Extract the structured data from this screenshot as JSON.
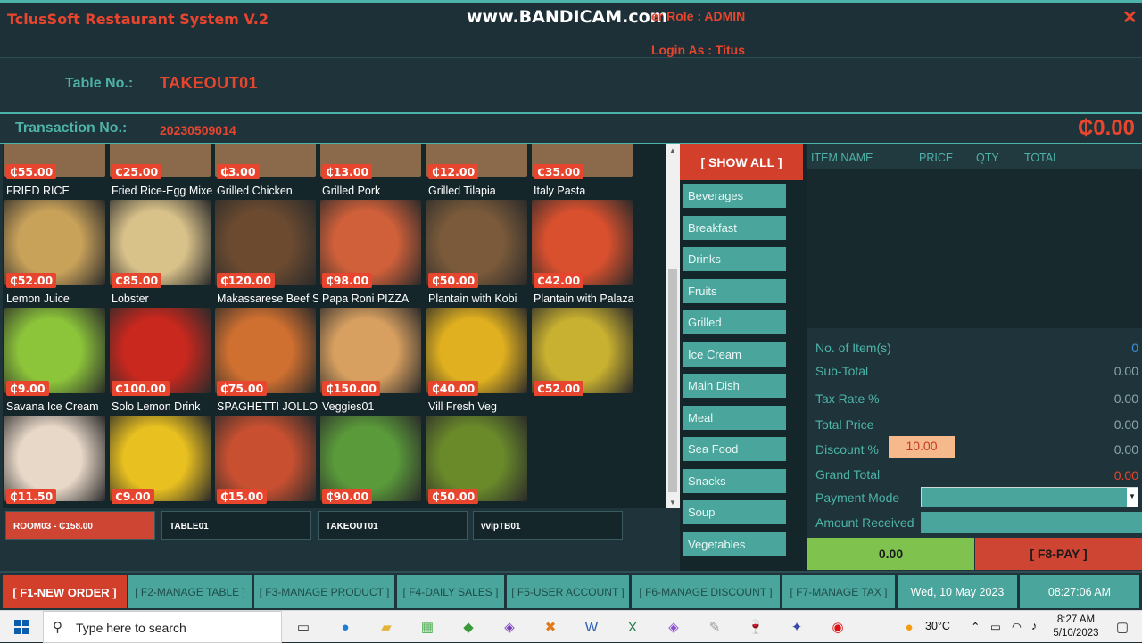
{
  "header": {
    "app_title": "TclusSoft Restaurant System V.2",
    "watermark": "www.BANDICAM.com",
    "user_role": "er Role : ADMIN",
    "login_as": "Login As : Titus",
    "table_label": "Table No.:",
    "table_value": "TAKEOUT01",
    "transaction_label": "Transaction No.:",
    "transaction_value": "20230509014",
    "grand_total_display": "₵0.00"
  },
  "products_top_row_prices": [
    "₵55.00",
    "₵25.00",
    "₵3.00",
    "₵13.00",
    "₵12.00",
    "₵35.00"
  ],
  "products": [
    {
      "name": "FRIED RICE",
      "price": "₵52.00",
      "color": "#c9a25a"
    },
    {
      "name": "Fried Rice-Egg Mixe",
      "price": "₵85.00",
      "color": "#d9c28a"
    },
    {
      "name": "Grilled Chicken",
      "price": "₵120.00",
      "color": "#6b4a30"
    },
    {
      "name": "Grilled Pork",
      "price": "₵98.00",
      "color": "#d0603a"
    },
    {
      "name": "Grilled Tilapia",
      "price": "₵50.00",
      "color": "#7a5a3a"
    },
    {
      "name": "Italy Pasta",
      "price": "₵42.00",
      "color": "#d8502e"
    },
    {
      "name": "Lemon Juice",
      "price": "₵9.00",
      "color": "#8cc43a"
    },
    {
      "name": "Lobster",
      "price": "₵100.00",
      "color": "#c8281e"
    },
    {
      "name": "Makassarese Beef S",
      "price": "₵75.00",
      "color": "#d07030"
    },
    {
      "name": "Papa Roni PIZZA",
      "price": "₵150.00",
      "color": "#d8a060"
    },
    {
      "name": "Plantain with Kobi",
      "price": "₵40.00",
      "color": "#e0b020"
    },
    {
      "name": "Plantain with Palaza",
      "price": "₵52.00",
      "color": "#c8b030"
    },
    {
      "name": "Savana Ice Cream",
      "price": "₵11.50",
      "color": "#e8d8c8"
    },
    {
      "name": "Solo Lemon Drink",
      "price": "₵9.00",
      "color": "#e8c020"
    },
    {
      "name": "SPAGHETTI JOLLOF",
      "price": "₵15.00",
      "color": "#c85030"
    },
    {
      "name": "Veggies01",
      "price": "₵90.00",
      "color": "#5a9a3a"
    },
    {
      "name": "Vill Fresh Veg",
      "price": "₵50.00",
      "color": "#6a8a2a"
    }
  ],
  "open_tables": [
    {
      "label": "ROOM03 - ₵158.00",
      "active": true
    },
    {
      "label": "TABLE01",
      "active": false
    },
    {
      "label": "TAKEOUT01",
      "active": false
    },
    {
      "label": "vvipTB01",
      "active": false
    }
  ],
  "categories": {
    "show_all": "[ SHOW ALL ]",
    "items": [
      "Beverages",
      "Breakfast",
      "Drinks",
      "Fruits",
      "Grilled",
      "Ice Cream",
      "Main Dish",
      "Meal",
      "Sea Food",
      "Snacks",
      "Soup",
      "Vegetables"
    ]
  },
  "order": {
    "columns": [
      "ITEM NAME",
      "PRICE",
      "QTY",
      "TOTAL"
    ],
    "summary": {
      "items_label": "No. of Item(s)",
      "items_value": "0",
      "subtotal_label": "Sub-Total",
      "subtotal_value": "0.00",
      "tax_label": "Tax Rate %",
      "tax_value": "0.00",
      "total_label": "Total Price",
      "total_value": "0.00",
      "discount_label": "Discount %",
      "discount_input": "10.00",
      "discount_value": "0.00",
      "grand_label": "Grand Total",
      "grand_value": "0.00",
      "payment_mode_label": "Payment Mode",
      "amount_received_label": "Amount Received"
    },
    "change_value": "0.00",
    "pay_button": "[ F8-PAY ]"
  },
  "function_bar": {
    "new_order": "[ F1-NEW ORDER ]",
    "manage_table": "[ F2-MANAGE TABLE ]",
    "manage_product": "[ F3-MANAGE PRODUCT ]",
    "daily_sales": "[ F4-DAILY SALES ]",
    "user_account": "[ F5-USER ACCOUNT ]",
    "manage_discount": "[ F6-MANAGE DISCOUNT ]",
    "manage_tax": "[ F7-MANAGE TAX ]",
    "date": "Wed, 10 May 2023",
    "time": "08:27:06 AM"
  },
  "taskbar": {
    "search_placeholder": "Type here to search",
    "temperature": "30°C",
    "clock_time": "8:27 AM",
    "clock_date": "5/10/2023"
  },
  "colors": {
    "accent": "#4db3a8",
    "danger": "#e8452e",
    "background": "#1f343a"
  }
}
